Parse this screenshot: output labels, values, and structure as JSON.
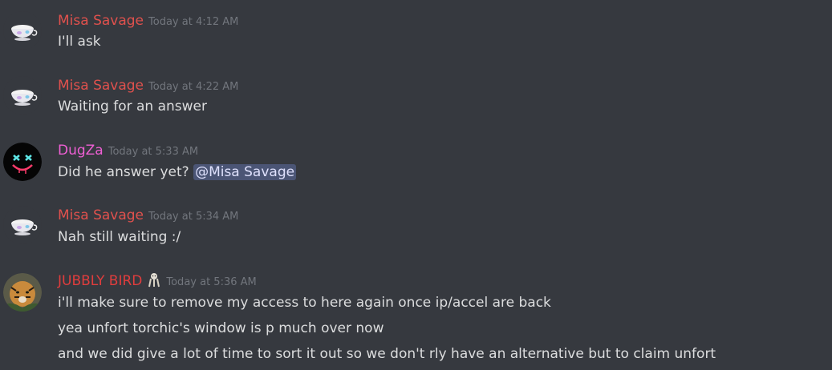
{
  "colors": {
    "background": "#36393f",
    "misa": "#e0514d",
    "dugza": "#ef5fd4",
    "jubbly": "#e03d3d",
    "text": "#dcddde",
    "timestamp": "#72767d"
  },
  "messages": [
    {
      "author": "Misa Savage",
      "timestamp": "Today at 4:12 AM",
      "avatar_icon": "teacup-icon",
      "lines": [
        "I'll ask"
      ]
    },
    {
      "author": "Misa Savage",
      "timestamp": "Today at 4:22 AM",
      "avatar_icon": "teacup-icon",
      "lines": [
        "Waiting for an answer"
      ]
    },
    {
      "author": "DugZa",
      "timestamp": "Today at 5:33 AM",
      "avatar_icon": "smiley-face-icon",
      "lines": [
        "Did he answer yet? "
      ],
      "mention": "@Misa Savage"
    },
    {
      "author": "Misa Savage",
      "timestamp": "Today at 5:34 AM",
      "avatar_icon": "teacup-icon",
      "lines": [
        "Nah still waiting :/"
      ]
    },
    {
      "author": "JUBBLY BIRD",
      "timestamp": "Today at 5:36 AM",
      "avatar_icon": "tiger-icon",
      "badge_icon": "bird-badge-icon",
      "lines": [
        "i'll make sure to remove my access to here again once ip/accel are back",
        "yea unfort torchic's window is p much over now",
        "and we did give a lot of time to sort it out so we don't rly have an alternative but to claim unfort"
      ]
    }
  ]
}
